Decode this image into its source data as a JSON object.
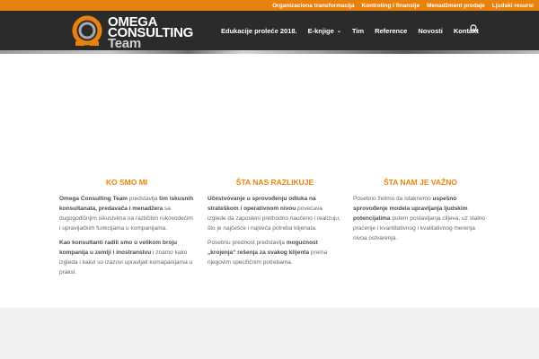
{
  "topbar": {
    "links": [
      "Organizaciona transformacija",
      "Kontroling i finansije",
      "Menadžment prodaje",
      "Ljudski resursi"
    ]
  },
  "logo": {
    "line1": "OMEGA",
    "line2": "CONSULTING",
    "line3": "Team"
  },
  "nav": {
    "items": [
      {
        "label": "Edukacije proleće 2018.",
        "caret": false
      },
      {
        "label": "E-knjige",
        "caret": true
      },
      {
        "label": "Tim",
        "caret": false
      },
      {
        "label": "Reference",
        "caret": false
      },
      {
        "label": "Novosti",
        "caret": false
      },
      {
        "label": "Kontakt",
        "caret": false
      }
    ],
    "caret_glyph": "⌄",
    "search_icon": "search-icon"
  },
  "columns": [
    {
      "title": "KO SMO MI",
      "paragraphs": [
        [
          {
            "t": "Omega Consulting Team",
            "b": true
          },
          {
            "t": " predstavlja ",
            "b": false
          },
          {
            "t": "tim iskusnih konsultanata, predavača i menadžera",
            "b": true
          },
          {
            "t": " sa dugogodišnjim iskustvima na različitim rukovodećim i upravljačkim funkcijama u kompanijama.",
            "b": false
          }
        ],
        [
          {
            "t": "Kao konsultanti radili smo u velikom broju kompanija u zemlji i inostranstvu",
            "b": true
          },
          {
            "t": " i znamo kako izgleda i kakvi su izazovi upravljati komapanijama u praksi.",
            "b": false
          }
        ]
      ]
    },
    {
      "title": "ŠTA NAS RAZLIKUJE",
      "paragraphs": [
        [
          {
            "t": "Učestvovanje u sprovođenju odluka na strateškom i operativnom nivou",
            "b": true
          },
          {
            "t": " povećava izglede da zaposleni prethodno naučeno i realizuju, što je najčešće i najveća potreba klijenata.",
            "b": false
          }
        ],
        [
          {
            "t": "Posebnu prednost predstavlja ",
            "b": false
          },
          {
            "t": "mogućnost „krojenja“",
            "b": true
          },
          {
            "t": " rešenja za svakog klijenta",
            "b": true
          },
          {
            "t": " prema njegovim specifičnim potrebama.",
            "b": false
          }
        ]
      ]
    },
    {
      "title": "ŠTA NAM JE VAŽNO",
      "paragraphs": [
        [
          {
            "t": "Posebno želimo da istaknemo ",
            "b": false
          },
          {
            "t": "uspešno sprovođenje modela upravljanja ljudskim potencijalima",
            "b": true
          },
          {
            "t": " putem postavljanja ciljeva, uz stalno praćenje i kvantitativnog i kvalitativnog merenja nivoa ostvarenja.",
            "b": false
          }
        ]
      ]
    }
  ],
  "colors": {
    "accent": "#e8820c",
    "header_bg": "#2b2b2b",
    "body_text": "#666666",
    "footer_bg": "#f0f0f0"
  }
}
